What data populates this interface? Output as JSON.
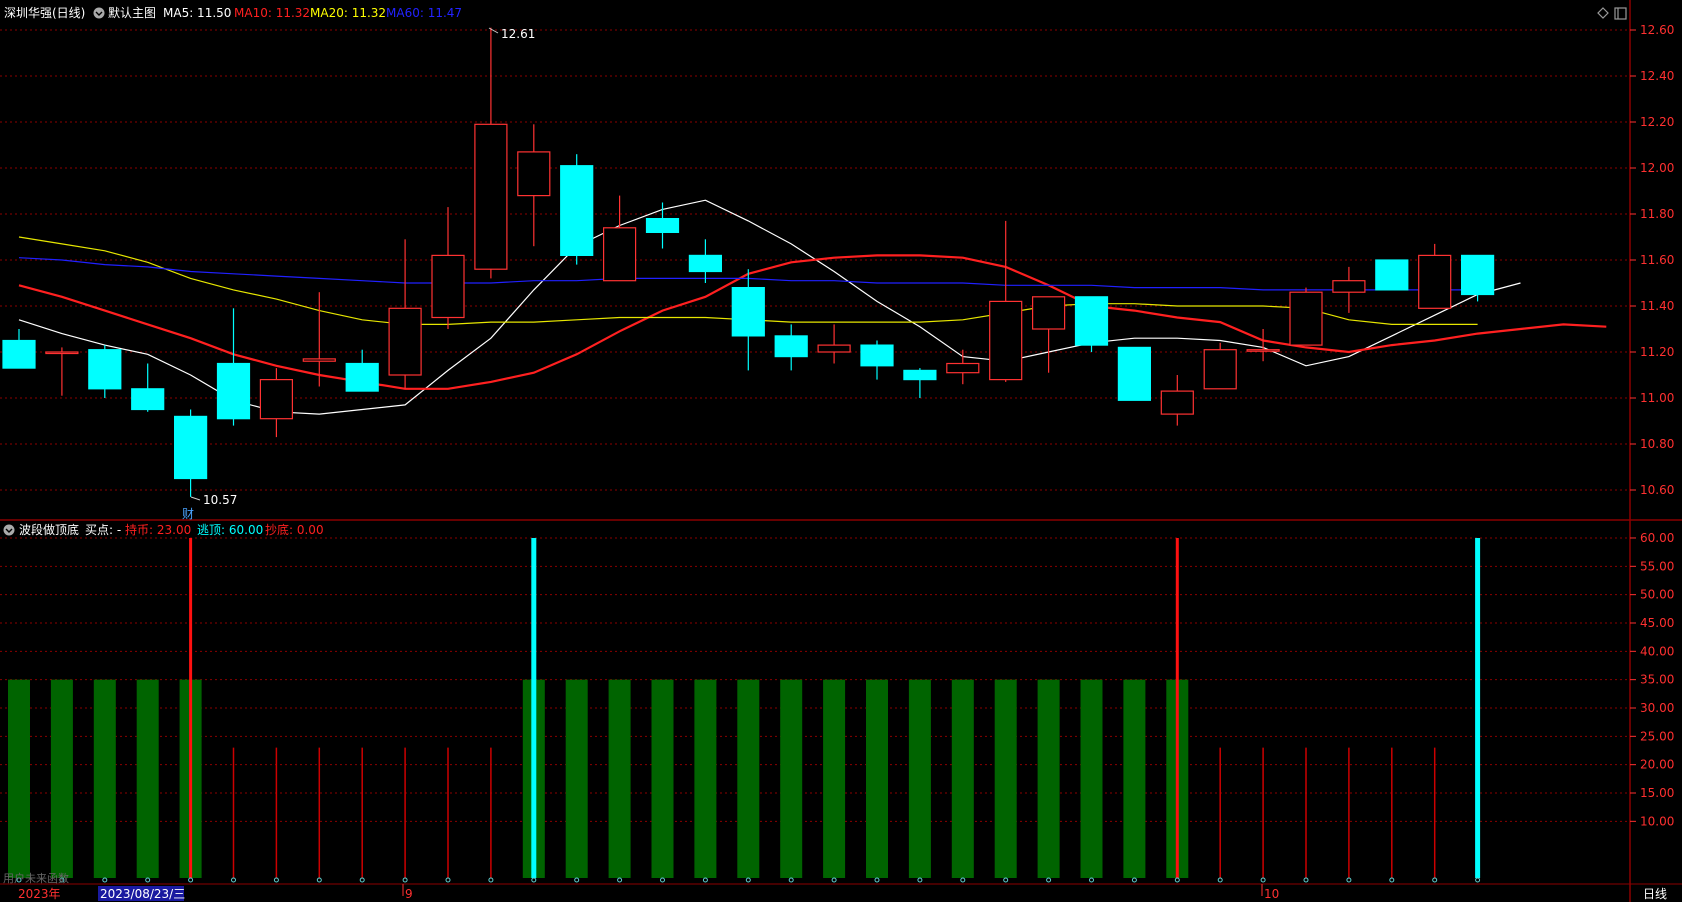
{
  "main": {
    "title": "深圳华强(日线)",
    "template_label": "默认主图",
    "legend": [
      {
        "label": "MA5: 11.50",
        "color": "#ffffff"
      },
      {
        "label": "MA10: 11.32",
        "color": "#ff2020"
      },
      {
        "label": "MA20: 11.32",
        "color": "#ffff00"
      },
      {
        "label": "MA60: 11.47",
        "color": "#2222ff"
      }
    ],
    "high_label": "12.61",
    "low_label": "10.57",
    "event_marker": "财",
    "y_ticks": [
      "12.60",
      "12.40",
      "12.20",
      "12.00",
      "11.80",
      "11.60",
      "11.40",
      "11.20",
      "11.00",
      "10.80",
      "10.60"
    ]
  },
  "indicator": {
    "title": "波段做顶底",
    "buy_label": "买点: -",
    "legend": [
      {
        "label": "持币: 23.00",
        "color": "#ff2020"
      },
      {
        "label": "逃顶: 60.00",
        "color": "#00ffff"
      },
      {
        "label": "抄底: 0.00",
        "color": "#ff2020"
      }
    ],
    "y_ticks": [
      "60.00",
      "55.00",
      "50.00",
      "45.00",
      "40.00",
      "35.00",
      "30.00",
      "25.00",
      "20.00",
      "15.00",
      "10.00"
    ],
    "footer_text": "用户未来函数"
  },
  "x_axis": {
    "labels": [
      {
        "text": "2023年",
        "color": "#ff3030"
      },
      {
        "text": "2023/08/23/三",
        "color": "#ffffff",
        "highlight": true
      },
      {
        "text": "9",
        "color": "#ff3030"
      },
      {
        "text": "10",
        "color": "#ff3030"
      }
    ],
    "period_button": "日线"
  },
  "colors": {
    "up": "#ff3232",
    "down": "#00ffff",
    "hold": "#006400",
    "grid": "#8b0000",
    "ma5": "#ffffff",
    "ma10": "#ff2020",
    "ma20": "#e6e600",
    "ma60": "#2020ff"
  },
  "icons": [
    "diamond-icon",
    "panel-toggle-icon",
    "collapse-icon"
  ],
  "chart_data": [
    {
      "type": "candlestick",
      "title": "深圳华强(日线)",
      "ylim": [
        10.5,
        12.64
      ],
      "candles": [
        {
          "o": 11.25,
          "c": 11.13,
          "h": 11.3,
          "l": 11.13
        },
        {
          "o": 11.2,
          "c": 11.2,
          "h": 11.22,
          "l": 11.01
        },
        {
          "o": 11.21,
          "c": 11.04,
          "h": 11.23,
          "l": 11.0
        },
        {
          "o": 11.04,
          "c": 10.95,
          "h": 11.15,
          "l": 10.94
        },
        {
          "o": 10.92,
          "c": 10.65,
          "h": 10.95,
          "l": 10.57
        },
        {
          "o": 11.15,
          "c": 10.91,
          "h": 11.39,
          "l": 10.88
        },
        {
          "o": 10.91,
          "c": 11.08,
          "h": 11.13,
          "l": 10.83
        },
        {
          "o": 11.16,
          "c": 11.17,
          "h": 11.46,
          "l": 11.05
        },
        {
          "o": 11.15,
          "c": 11.03,
          "h": 11.21,
          "l": 11.03
        },
        {
          "o": 11.1,
          "c": 11.39,
          "h": 11.69,
          "l": 11.04
        },
        {
          "o": 11.35,
          "c": 11.62,
          "h": 11.83,
          "l": 11.3
        },
        {
          "o": 11.56,
          "c": 12.19,
          "h": 12.61,
          "l": 11.52
        },
        {
          "o": 11.88,
          "c": 12.07,
          "h": 12.19,
          "l": 11.66
        },
        {
          "o": 12.01,
          "c": 11.62,
          "h": 12.06,
          "l": 11.58
        },
        {
          "o": 11.51,
          "c": 11.74,
          "h": 11.88,
          "l": 11.51
        },
        {
          "o": 11.78,
          "c": 11.72,
          "h": 11.85,
          "l": 11.65
        },
        {
          "o": 11.62,
          "c": 11.55,
          "h": 11.69,
          "l": 11.5
        },
        {
          "o": 11.48,
          "c": 11.27,
          "h": 11.56,
          "l": 11.12
        },
        {
          "o": 11.27,
          "c": 11.18,
          "h": 11.32,
          "l": 11.12
        },
        {
          "o": 11.2,
          "c": 11.23,
          "h": 11.32,
          "l": 11.15
        },
        {
          "o": 11.23,
          "c": 11.14,
          "h": 11.25,
          "l": 11.08
        },
        {
          "o": 11.12,
          "c": 11.08,
          "h": 11.13,
          "l": 11.0
        },
        {
          "o": 11.11,
          "c": 11.15,
          "h": 11.21,
          "l": 11.06
        },
        {
          "o": 11.08,
          "c": 11.42,
          "h": 11.77,
          "l": 11.07
        },
        {
          "o": 11.3,
          "c": 11.44,
          "h": 11.44,
          "l": 11.11
        },
        {
          "o": 11.44,
          "c": 11.23,
          "h": 11.44,
          "l": 11.2
        },
        {
          "o": 11.22,
          "c": 10.99,
          "h": 11.22,
          "l": 10.99
        },
        {
          "o": 10.93,
          "c": 11.03,
          "h": 11.1,
          "l": 10.88
        },
        {
          "o": 11.04,
          "c": 11.21,
          "h": 11.24,
          "l": 11.04
        },
        {
          "o": 11.21,
          "c": 11.21,
          "h": 11.3,
          "l": 11.16
        },
        {
          "o": 11.23,
          "c": 11.46,
          "h": 11.48,
          "l": 11.23
        },
        {
          "o": 11.46,
          "c": 11.51,
          "h": 11.57,
          "l": 11.37
        },
        {
          "o": 11.6,
          "c": 11.47,
          "h": 11.6,
          "l": 11.47
        },
        {
          "o": 11.39,
          "c": 11.62,
          "h": 11.67,
          "l": 11.39
        },
        {
          "o": 11.62,
          "c": 11.45,
          "h": 11.62,
          "l": 11.42
        }
      ],
      "series": [
        {
          "name": "MA5",
          "values": [
            11.34,
            11.28,
            11.23,
            11.19,
            11.1,
            10.99,
            10.94,
            10.93,
            10.95,
            10.97,
            11.12,
            11.26,
            11.47,
            11.66,
            11.75,
            11.82,
            11.86,
            11.77,
            11.67,
            11.55,
            11.42,
            11.31,
            11.18,
            11.16,
            11.2,
            11.24,
            11.26,
            11.26,
            11.25,
            11.22,
            11.14,
            11.18,
            11.27,
            11.36,
            11.45,
            11.5
          ]
        },
        {
          "name": "MA10",
          "values": [
            11.49,
            11.44,
            11.38,
            11.32,
            11.26,
            11.19,
            11.14,
            11.1,
            11.07,
            11.04,
            11.04,
            11.07,
            11.11,
            11.19,
            11.29,
            11.38,
            11.44,
            11.54,
            11.59,
            11.61,
            11.62,
            11.62,
            11.61,
            11.57,
            11.49,
            11.4,
            11.38,
            11.35,
            11.33,
            11.25,
            11.22,
            11.2,
            11.23,
            11.25,
            11.28,
            11.3,
            11.32,
            11.31
          ]
        },
        {
          "name": "MA20",
          "values": [
            11.7,
            11.67,
            11.64,
            11.59,
            11.52,
            11.47,
            11.43,
            11.38,
            11.34,
            11.32,
            11.32,
            11.33,
            11.33,
            11.34,
            11.35,
            11.35,
            11.35,
            11.34,
            11.33,
            11.33,
            11.33,
            11.33,
            11.34,
            11.37,
            11.4,
            11.41,
            11.41,
            11.4,
            11.4,
            11.4,
            11.39,
            11.34,
            11.32,
            11.32,
            11.32
          ]
        },
        {
          "name": "MA60",
          "values": [
            11.61,
            11.6,
            11.58,
            11.57,
            11.55,
            11.54,
            11.53,
            11.52,
            11.51,
            11.5,
            11.5,
            11.5,
            11.51,
            11.51,
            11.52,
            11.52,
            11.52,
            11.52,
            11.51,
            11.51,
            11.5,
            11.5,
            11.5,
            11.49,
            11.49,
            11.49,
            11.48,
            11.48,
            11.48,
            11.47,
            11.47,
            11.47,
            11.47,
            11.47,
            11.47
          ]
        }
      ]
    },
    {
      "type": "bar",
      "title": "波段做顶底",
      "ylim": [
        0,
        60
      ],
      "series": [
        {
          "name": "持币",
          "values": [
            35,
            35,
            35,
            35,
            35,
            23,
            23,
            23,
            23,
            23,
            23,
            23,
            35,
            35,
            35,
            35,
            35,
            35,
            35,
            35,
            35,
            35,
            35,
            35,
            35,
            35,
            35,
            35,
            23,
            23,
            23,
            23,
            23,
            23,
            0
          ]
        },
        {
          "name": "逃顶",
          "values": [
            0,
            0,
            0,
            0,
            0,
            0,
            0,
            0,
            0,
            0,
            0,
            0,
            60,
            0,
            0,
            0,
            0,
            0,
            0,
            0,
            0,
            0,
            0,
            0,
            0,
            0,
            0,
            0,
            0,
            0,
            0,
            0,
            0,
            0,
            60
          ]
        },
        {
          "name": "抄底",
          "values": [
            0,
            0,
            0,
            0,
            60,
            0,
            0,
            0,
            0,
            0,
            0,
            0,
            0,
            0,
            0,
            0,
            0,
            0,
            0,
            0,
            0,
            0,
            0,
            0,
            0,
            0,
            0,
            60,
            0,
            0,
            0,
            0,
            0,
            0,
            0
          ]
        }
      ]
    }
  ]
}
